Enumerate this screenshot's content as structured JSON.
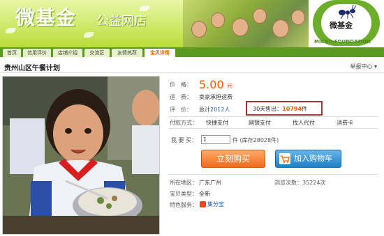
{
  "banner": {
    "brand": "微基金",
    "brand_sub": "公益网店",
    "logo_cn": "微基金",
    "logo_en": "MICR✿-FOUNDATION"
  },
  "nav": {
    "tabs": [
      {
        "label": "首页"
      },
      {
        "label": "信用评价"
      },
      {
        "label": "店铺介绍"
      },
      {
        "label": "交流区"
      },
      {
        "label": "友情热荐"
      },
      {
        "label": "宝贝详情"
      }
    ]
  },
  "item": {
    "title": "贵州山区午餐计划",
    "report": "举报中心",
    "price_label": "价　格：",
    "price": "5.00",
    "price_unit": "元",
    "shipping_label": "运　费：",
    "shipping_value": "卖家承担运费",
    "rating_label": "评　价：",
    "rating_prefix": "总计",
    "rating_count": "2012人",
    "sales_label": "30天售出：",
    "sales_count": "10794",
    "sales_unit": "件",
    "payment_label": "付款方式：",
    "payments": [
      "快捷支付",
      "网银支付",
      "找人代付",
      "消费卡"
    ],
    "buy_label": "我 要 买：",
    "quantity": "1",
    "stock_text": "件 (库存28028件)",
    "buy_now": "立刻购买",
    "add_cart": "加入购物车",
    "location_label": "所在地区：",
    "location_value": "广东广州",
    "views_text": "浏览次数：35224次",
    "type_label": "宝贝类型：",
    "type_value": "全新",
    "service_label": "特色服务：",
    "service_value": "集分宝"
  },
  "colors": {
    "accent_orange": "#ff5a00",
    "nav_green": "#5b9a1e",
    "link_blue": "#1a5aa8"
  }
}
